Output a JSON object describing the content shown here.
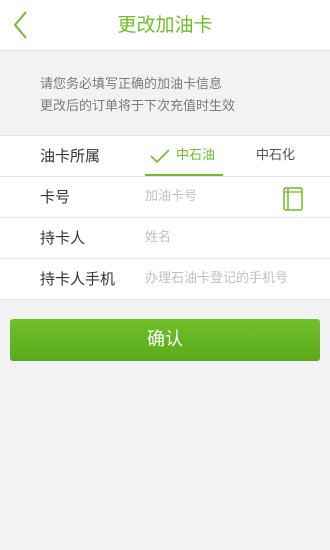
{
  "header": {
    "title": "更改加油卡",
    "back_icon": "chevron-left-icon"
  },
  "notice": {
    "line1": "请您务必填写正确的加油卡信息",
    "line2": "更改后的订单将于下次充值时生效"
  },
  "form": {
    "card_owner": {
      "label": "油卡所属",
      "options": [
        {
          "label": "中石油",
          "selected": true
        },
        {
          "label": "中石化",
          "selected": false
        }
      ]
    },
    "card_number": {
      "label": "卡号",
      "placeholder": "加油卡号",
      "icon": "card-scan-icon"
    },
    "card_holder": {
      "label": "持卡人",
      "placeholder": "姓名"
    },
    "holder_phone": {
      "label": "持卡人手机",
      "placeholder": "办理石油卡登记的手机号"
    }
  },
  "confirm_button": {
    "label": "确认"
  },
  "colors": {
    "accent": "#6dbf2a",
    "background": "#f2f2f2"
  }
}
